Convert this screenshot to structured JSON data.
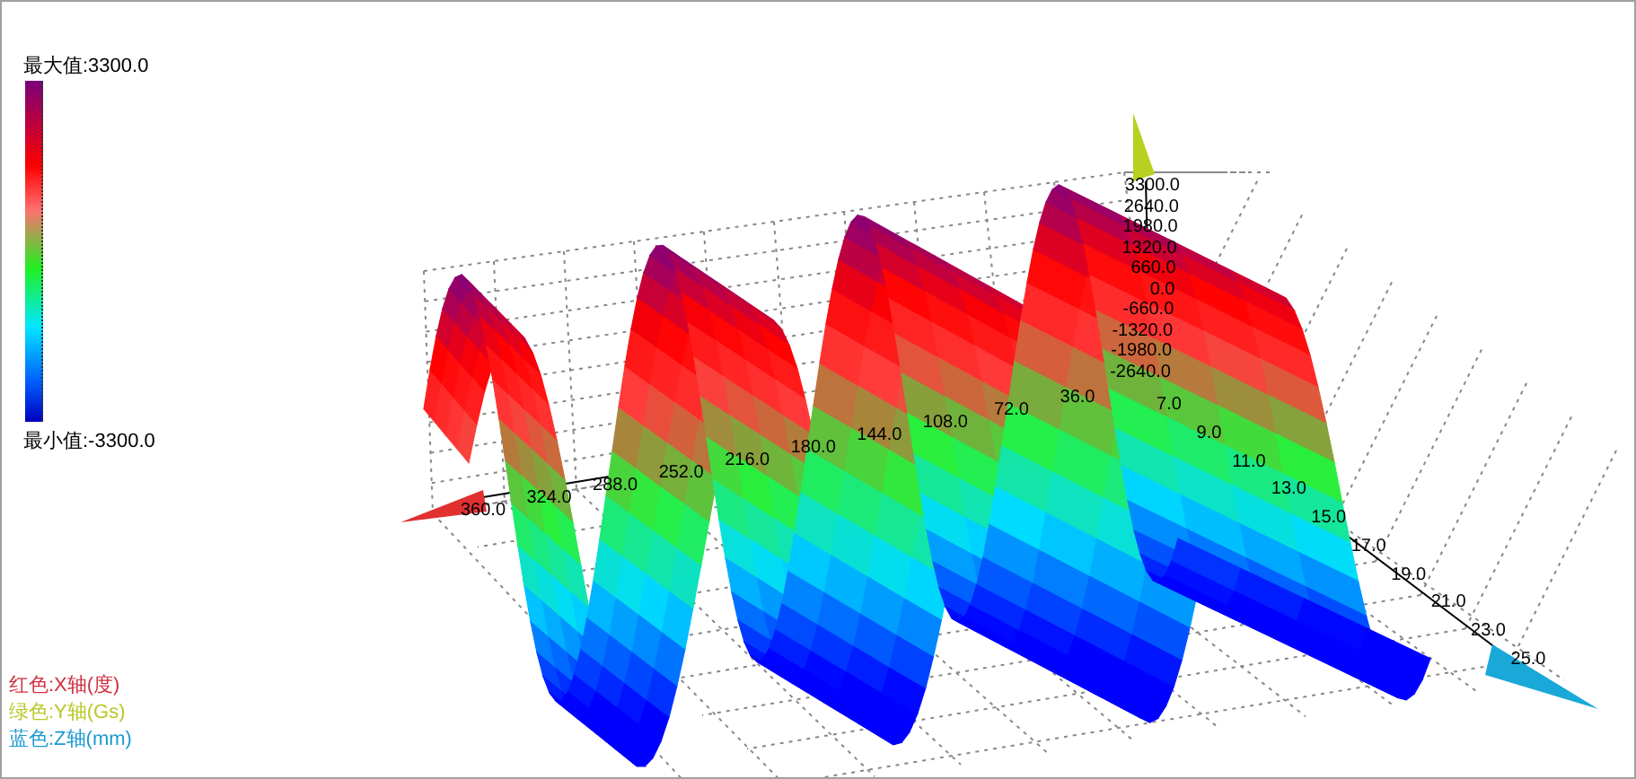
{
  "color_scale": {
    "max_label": "最大值:3300.0",
    "min_label": "最小值:-3300.0"
  },
  "x_axis": {
    "ticks": [
      "360.0",
      "324.0",
      "288.0",
      "252.0",
      "216.0",
      "180.0",
      "144.0",
      "108.0",
      "72.0",
      "36.0"
    ]
  },
  "y_axis": {
    "ticks": [
      "3300.0",
      "2640.0",
      "1980.0",
      "1320.0",
      "660.0",
      "0.0",
      "-660.0",
      "-1320.0",
      "-1980.0",
      "-2640.0"
    ]
  },
  "z_axis": {
    "ticks": [
      "7.0",
      "9.0",
      "11.0",
      "13.0",
      "15.0",
      "17.0",
      "19.0",
      "21.0",
      "23.0",
      "25.0"
    ]
  },
  "axis_legend": [
    {
      "label": "红色:X轴(度)",
      "color": "#d03040"
    },
    {
      "label": "绿色:Y轴(Gs)",
      "color": "#b8c828"
    },
    {
      "label": "蓝色:Z轴(mm)",
      "color": "#1a9ad0"
    }
  ]
}
